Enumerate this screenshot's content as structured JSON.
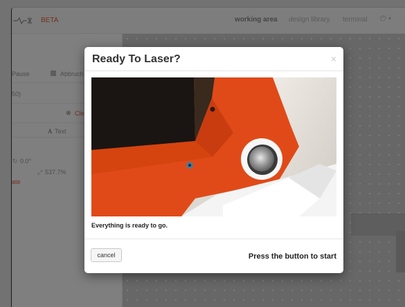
{
  "app": {
    "beta_label": "BETA",
    "nav": [
      "working area",
      "design library",
      "terminal"
    ],
    "power_label": "⏻ ▾"
  },
  "sidebar": {
    "pause_label": "Pause",
    "abort_label": "Abbruch",
    "coordinate_text": "50)",
    "clear_label": "Cle",
    "text_tool_label": "Text",
    "rotation_text": "0.0°",
    "scale_text": "537.7%",
    "link_text": "ate"
  },
  "modal": {
    "title": "Ready To Laser?",
    "close_label": "×",
    "message": "Everything is ready to go.",
    "cancel_label": "cancel",
    "press_label": "Press the button to start"
  },
  "colors": {
    "accent": "#e8623e",
    "frame_orange": "#e04a18"
  }
}
